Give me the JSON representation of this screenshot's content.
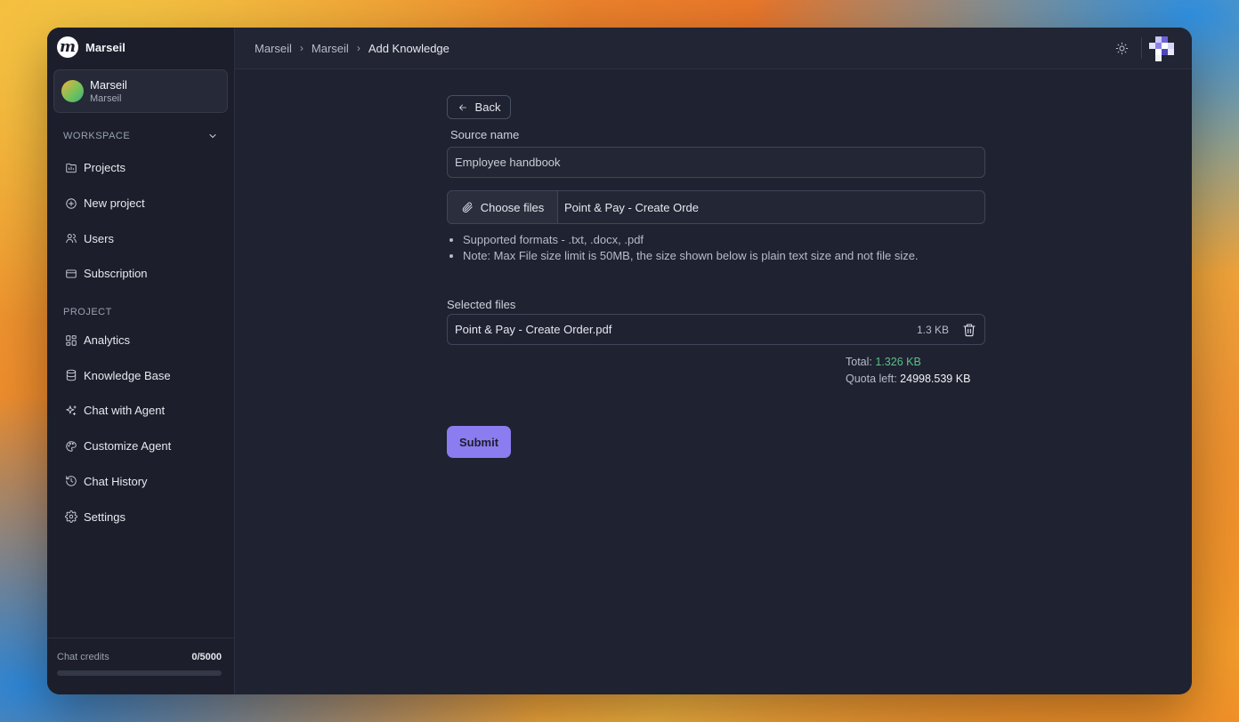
{
  "app": {
    "name": "Marseil",
    "logo_letter": "m"
  },
  "project_card": {
    "title": "Marseil",
    "subtitle": "Marseil"
  },
  "sidebar": {
    "workspace_heading": "WORKSPACE",
    "workspace_items": [
      {
        "label": "Projects",
        "icon": "folder-icon"
      },
      {
        "label": "New project",
        "icon": "plus-circle-icon"
      },
      {
        "label": "Users",
        "icon": "users-icon"
      },
      {
        "label": "Subscription",
        "icon": "credit-card-icon"
      }
    ],
    "project_heading": "PROJECT",
    "project_items": [
      {
        "label": "Analytics",
        "icon": "grid-icon"
      },
      {
        "label": "Knowledge Base",
        "icon": "database-icon"
      },
      {
        "label": "Chat with Agent",
        "icon": "sparkles-icon"
      },
      {
        "label": "Customize Agent",
        "icon": "palette-icon"
      },
      {
        "label": "Chat History",
        "icon": "history-icon"
      },
      {
        "label": "Settings",
        "icon": "gear-icon"
      }
    ],
    "credits": {
      "label": "Chat credits",
      "value": "0/5000",
      "fraction": 0
    }
  },
  "breadcrumb": [
    "Marseil",
    "Marseil",
    "Add Knowledge"
  ],
  "form": {
    "back_label": "Back",
    "source_label": "Source name",
    "source_value": "Employee handbook",
    "choose_label": "Choose files",
    "chosen_file": "Point & Pay - Create Orde",
    "notes": [
      "Supported formats - .txt, .docx, .pdf",
      "Note: Max File size limit is 50MB, the size shown below is plain text size and not file size."
    ],
    "selected_label": "Selected files",
    "files": [
      {
        "name": "Point & Pay - Create Order.pdf",
        "size": "1.3 KB"
      }
    ],
    "total_label": "Total:",
    "total_value": "1.326 KB",
    "quota_label": "Quota left:",
    "quota_value": "24998.539 KB",
    "submit_label": "Submit"
  },
  "colors": {
    "accent": "#8b7cf0",
    "success": "#59c18a",
    "panel": "#1f2230"
  }
}
